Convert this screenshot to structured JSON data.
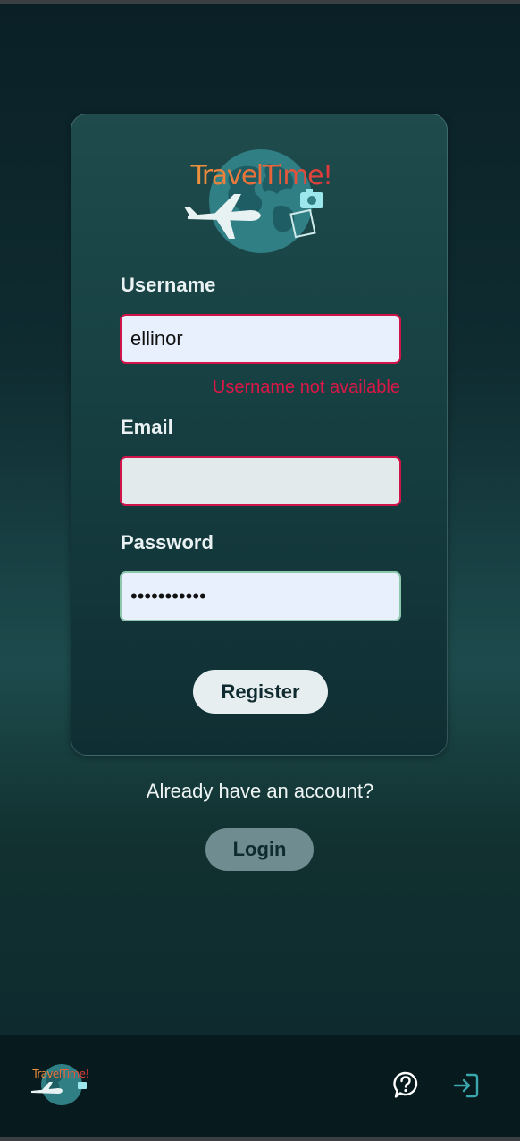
{
  "app": {
    "logo_text": "TravelTime!"
  },
  "form": {
    "username": {
      "label": "Username",
      "value": "ellinor",
      "error": "Username not available"
    },
    "email": {
      "label": "Email",
      "value": ""
    },
    "password": {
      "label": "Password",
      "value": "•••••••••••"
    },
    "register_label": "Register"
  },
  "account_prompt": "Already have an account?",
  "login_label": "Login",
  "footer": {
    "logo_text": "TravelTime!",
    "icons": [
      "help-icon",
      "login-icon"
    ]
  },
  "colors": {
    "accent_teal": "#1d4b4d",
    "error": "#dc1747",
    "valid_border": "#8ec8ac",
    "logo_gradient_start": "#f0a13d",
    "logo_gradient_end": "#d9253e"
  }
}
